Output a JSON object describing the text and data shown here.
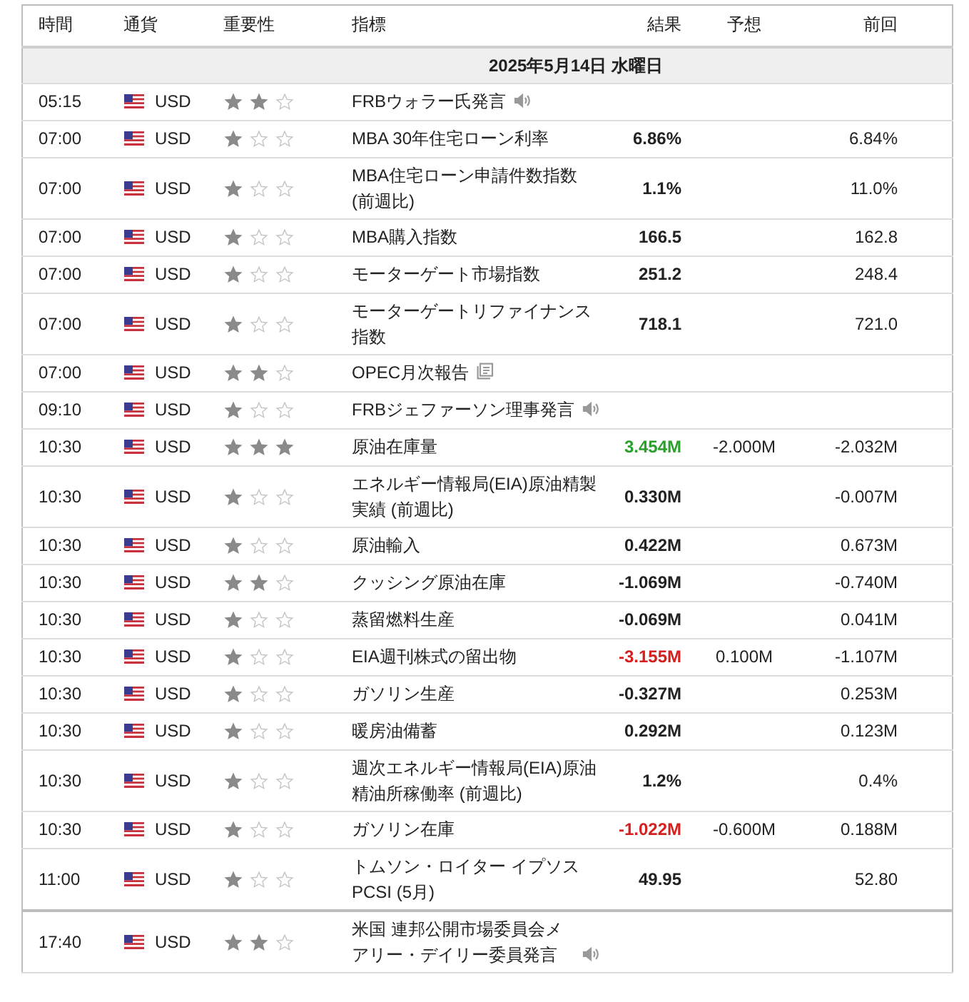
{
  "table": {
    "columns": [
      "時間",
      "通貨",
      "重要性",
      "指標",
      "結果",
      "予想",
      "前回"
    ],
    "date_row": "2025年5月14日 水曜日",
    "rows": [
      {
        "time": "05:15",
        "currency": "USD",
        "stars": 2,
        "event": "FRBウォラー氏発言",
        "kind": "speech",
        "new_group": false
      },
      {
        "time": "07:00",
        "currency": "USD",
        "stars": 1,
        "event": "MBA 30年住宅ローン利率",
        "kind": "release",
        "actual": "6.86%",
        "color": "#222222",
        "previous": "6.84%",
        "new_group": false
      },
      {
        "time": "07:00",
        "currency": "USD",
        "stars": 1,
        "event": "MBA住宅ローン申請件数指数 (前週比)",
        "kind": "release",
        "actual": "1.1%",
        "color": "#222222",
        "previous": "11.0%",
        "new_group": false
      },
      {
        "time": "07:00",
        "currency": "USD",
        "stars": 1,
        "event": "MBA購入指数",
        "kind": "release",
        "actual": "166.5",
        "color": "#222222",
        "previous": "162.8",
        "new_group": false
      },
      {
        "time": "07:00",
        "currency": "USD",
        "stars": 1,
        "event": "モーターゲート市場指数",
        "kind": "release",
        "actual": "251.2",
        "color": "#222222",
        "previous": "248.4",
        "new_group": false
      },
      {
        "time": "07:00",
        "currency": "USD",
        "stars": 1,
        "event": "モーターゲートリファイナンス指数",
        "kind": "release",
        "actual": "718.1",
        "color": "#222222",
        "previous": "721.0",
        "new_group": false
      },
      {
        "time": "07:00",
        "currency": "USD",
        "stars": 2,
        "event": "OPEC月次報告",
        "kind": "report",
        "new_group": false
      },
      {
        "time": "09:10",
        "currency": "USD",
        "stars": 1,
        "event": "FRBジェファーソン理事発言",
        "kind": "speech",
        "new_group": false
      },
      {
        "time": "10:30",
        "currency": "USD",
        "stars": 3,
        "event": "原油在庫量",
        "kind": "release",
        "actual": "3.454M",
        "color": "#2ca02c",
        "forecast": "-2.000M",
        "previous": "-2.032M",
        "new_group": false
      },
      {
        "time": "10:30",
        "currency": "USD",
        "stars": 1,
        "event": "エネルギー情報局(EIA)原油精製実績 (前週比)",
        "kind": "release",
        "actual": "0.330M",
        "color": "#222222",
        "previous": "-0.007M",
        "new_group": false
      },
      {
        "time": "10:30",
        "currency": "USD",
        "stars": 1,
        "event": "原油輸入",
        "kind": "release",
        "actual": "0.422M",
        "color": "#222222",
        "previous": "0.673M",
        "new_group": false
      },
      {
        "time": "10:30",
        "currency": "USD",
        "stars": 2,
        "event": "クッシング原油在庫",
        "kind": "release",
        "actual": "-1.069M",
        "color": "#222222",
        "previous": "-0.740M",
        "new_group": false
      },
      {
        "time": "10:30",
        "currency": "USD",
        "stars": 1,
        "event": "蒸留燃料生産",
        "kind": "release",
        "actual": "-0.069M",
        "color": "#222222",
        "previous": "0.041M",
        "new_group": false
      },
      {
        "time": "10:30",
        "currency": "USD",
        "stars": 1,
        "event": "EIA週刊株式の留出物",
        "kind": "release",
        "actual": "-3.155M",
        "color": "#d62020",
        "forecast": "0.100M",
        "previous": "-1.107M",
        "new_group": false
      },
      {
        "time": "10:30",
        "currency": "USD",
        "stars": 1,
        "event": "ガソリン生産",
        "kind": "release",
        "actual": "-0.327M",
        "color": "#222222",
        "previous": "0.253M",
        "new_group": false
      },
      {
        "time": "10:30",
        "currency": "USD",
        "stars": 1,
        "event": "暖房油備蓄",
        "kind": "release",
        "actual": "0.292M",
        "color": "#222222",
        "previous": "0.123M",
        "new_group": false
      },
      {
        "time": "10:30",
        "currency": "USD",
        "stars": 1,
        "event": "週次エネルギー情報局(EIA)原油精油所稼働率 (前週比)",
        "kind": "release",
        "actual": "1.2%",
        "color": "#222222",
        "previous": "0.4%",
        "new_group": false
      },
      {
        "time": "10:30",
        "currency": "USD",
        "stars": 1,
        "event": "ガソリン在庫",
        "kind": "release",
        "actual": "-1.022M",
        "color": "#d62020",
        "forecast": "-0.600M",
        "previous": "0.188M",
        "new_group": false
      },
      {
        "time": "11:00",
        "currency": "USD",
        "stars": 1,
        "event": "トムソン・ロイター イプソス PCSI (5月)",
        "kind": "release",
        "actual": "49.95",
        "color": "#222222",
        "previous": "52.80",
        "new_group": false
      },
      {
        "time": "17:40",
        "currency": "USD",
        "stars": 2,
        "event": "米国 連邦公開市場委員会メアリー・デイリー委員発言",
        "kind": "speech",
        "new_group": true
      }
    ]
  }
}
